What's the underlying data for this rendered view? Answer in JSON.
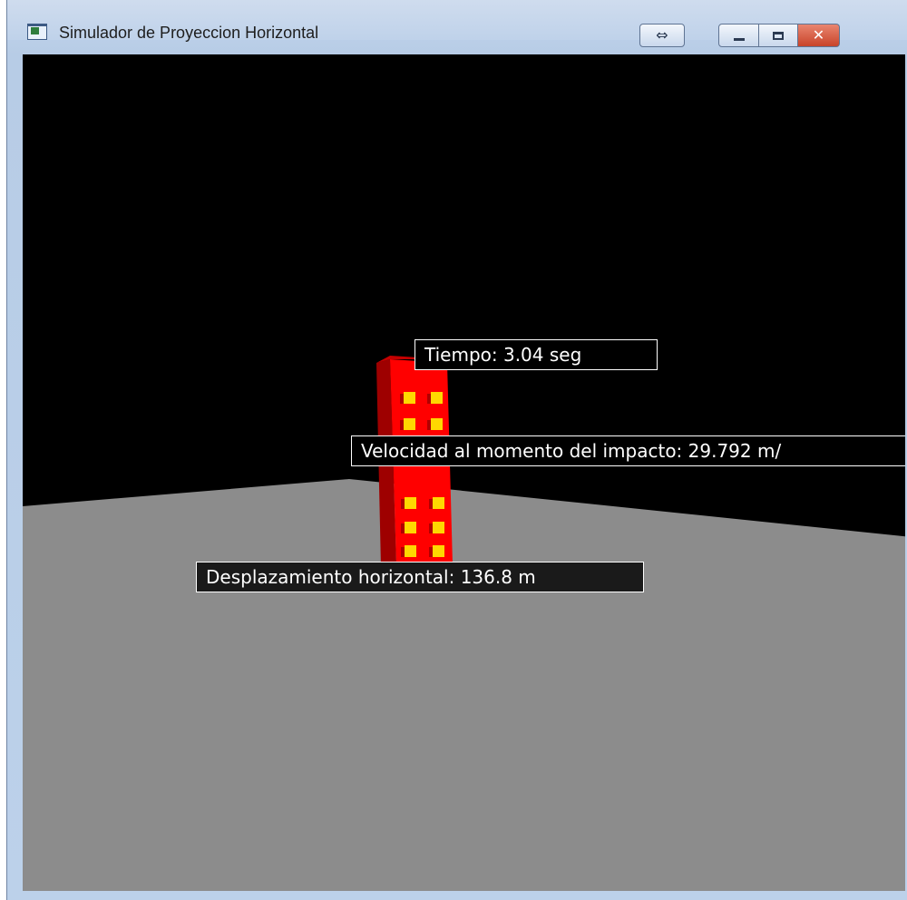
{
  "window": {
    "title": "Simulador de Proyeccion Horizontal",
    "buttons": {
      "resize": "⇔",
      "minimize": "",
      "maximize": "",
      "close": "✕"
    }
  },
  "scene": {
    "sky_color": "#000000",
    "ground_color": "#8c8c8c",
    "building_color": "#ff0000",
    "window_color": "#ffd800"
  },
  "hud": {
    "tiempo": "Tiempo: 3.04 seg",
    "velocidad": "Velocidad al momento del impacto: 29.792 m/",
    "desplazamiento": "Desplazamiento horizontal: 136.8 m"
  }
}
